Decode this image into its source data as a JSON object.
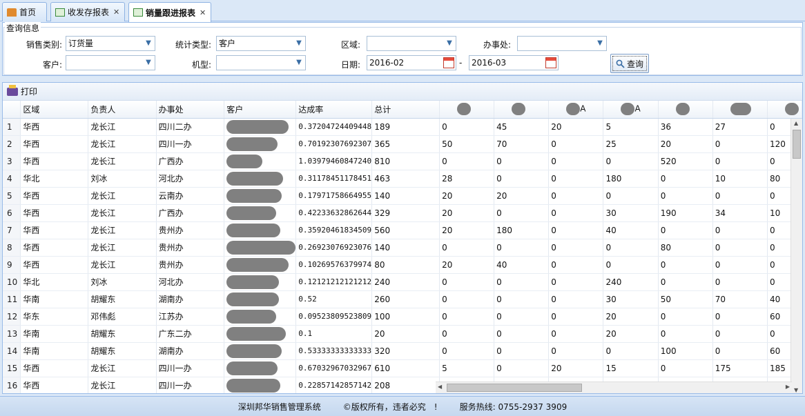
{
  "tabs": [
    {
      "label": "首页",
      "closable": false
    },
    {
      "label": "收发存报表",
      "closable": true
    },
    {
      "label": "销量跟进报表",
      "closable": true,
      "active": true
    }
  ],
  "query": {
    "title": "查询信息",
    "sales_type_label": "销售类别:",
    "sales_type_value": "订货量",
    "stat_type_label": "统计类型:",
    "stat_type_value": "客户",
    "region_label": "区域:",
    "region_value": "",
    "office_label": "办事处:",
    "office_value": "",
    "customer_label": "客户:",
    "customer_value": "",
    "model_label": "机型:",
    "model_value": "",
    "date_label": "日期:",
    "date_from": "2016-02",
    "date_to": "2016-03",
    "date_sep": "-",
    "query_button": "查询"
  },
  "grid": {
    "print_label": "打印",
    "columns": [
      "区域",
      "负责人",
      "办事处",
      "客户",
      "达成率",
      "总计",
      "",
      "",
      "A",
      "A",
      "",
      "",
      ""
    ],
    "rows": [
      [
        "1",
        "华西",
        "龙长江",
        "四川二办",
        "",
        "0.37204724409448",
        "189",
        "0",
        "45",
        "20",
        "5",
        "36",
        "27",
        "0"
      ],
      [
        "2",
        "华西",
        "龙长江",
        "四川一办",
        "",
        "0.70192307692307",
        "365",
        "50",
        "70",
        "0",
        "25",
        "20",
        "0",
        "120"
      ],
      [
        "3",
        "华西",
        "龙长江",
        "广西办",
        "",
        "1.03979460847240",
        "810",
        "0",
        "0",
        "0",
        "0",
        "520",
        "0",
        "0"
      ],
      [
        "4",
        "华北",
        "刘冰",
        "河北办",
        "",
        "0.31178451178451",
        "463",
        "28",
        "0",
        "0",
        "180",
        "0",
        "10",
        "80"
      ],
      [
        "5",
        "华西",
        "龙长江",
        "云南办",
        "",
        "0.17971758664955",
        "140",
        "20",
        "20",
        "0",
        "0",
        "0",
        "0",
        "0"
      ],
      [
        "6",
        "华西",
        "龙长江",
        "广西办",
        "",
        "0.42233632862644",
        "329",
        "20",
        "0",
        "0",
        "30",
        "190",
        "34",
        "10"
      ],
      [
        "7",
        "华西",
        "龙长江",
        "贵州办",
        "",
        "0.35920461834509",
        "560",
        "20",
        "180",
        "0",
        "40",
        "0",
        "0",
        "0"
      ],
      [
        "8",
        "华西",
        "龙长江",
        "贵州办",
        "",
        "0.26923076923076",
        "140",
        "0",
        "0",
        "0",
        "0",
        "80",
        "0",
        "0"
      ],
      [
        "9",
        "华西",
        "龙长江",
        "贵州办",
        "",
        "0.10269576379974",
        "80",
        "20",
        "40",
        "0",
        "0",
        "0",
        "0",
        "0"
      ],
      [
        "10",
        "华北",
        "刘冰",
        "河北办",
        "",
        "0.12121212121212",
        "240",
        "0",
        "0",
        "0",
        "240",
        "0",
        "0",
        "0"
      ],
      [
        "11",
        "华南",
        "胡耀东",
        "湖南办",
        "",
        "0.52",
        "260",
        "0",
        "0",
        "0",
        "30",
        "50",
        "70",
        "40"
      ],
      [
        "12",
        "华东",
        "邓伟彪",
        "江苏办",
        "",
        "0.09523809523809",
        "100",
        "0",
        "0",
        "0",
        "20",
        "0",
        "0",
        "60"
      ],
      [
        "13",
        "华南",
        "胡耀东",
        "广东二办",
        "",
        "0.1",
        "20",
        "0",
        "0",
        "0",
        "20",
        "0",
        "0",
        "0"
      ],
      [
        "14",
        "华南",
        "胡耀东",
        "湖南办",
        "",
        "0.53333333333333",
        "320",
        "0",
        "0",
        "0",
        "0",
        "100",
        "0",
        "60"
      ],
      [
        "15",
        "华西",
        "龙长江",
        "四川一办",
        "",
        "0.67032967032967",
        "610",
        "5",
        "0",
        "20",
        "15",
        "0",
        "175",
        "185"
      ],
      [
        "16",
        "华西",
        "龙长江",
        "四川一办",
        "",
        "0.22857142857142",
        "208",
        "",
        "",
        "",
        "",
        "",
        "",
        ""
      ]
    ]
  },
  "footer": {
    "system": "深圳邦华销售管理系统",
    "copyright": "©版权所有，违者必究　!",
    "hotline": "服务热线: 0755-2937 3909"
  }
}
